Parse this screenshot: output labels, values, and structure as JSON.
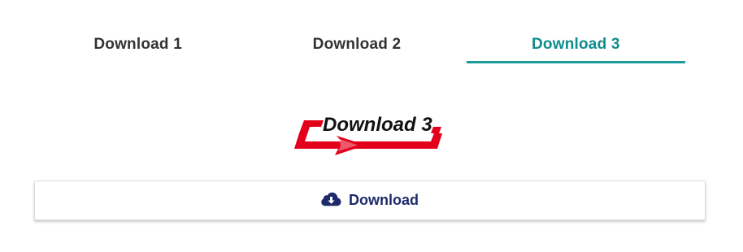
{
  "tabs": [
    {
      "label": "Download 1",
      "active": false
    },
    {
      "label": "Download 2",
      "active": false
    },
    {
      "label": "Download 3",
      "active": true
    }
  ],
  "logo": {
    "text": "Download 3",
    "colors": {
      "arrow": "#e3001b",
      "text": "#111111"
    }
  },
  "download_button": {
    "label": "Download",
    "icon": "cloud-download-icon"
  },
  "colors": {
    "accent": "#1a9c9c",
    "button_text": "#1d2a6b",
    "tab_text": "#333333"
  }
}
